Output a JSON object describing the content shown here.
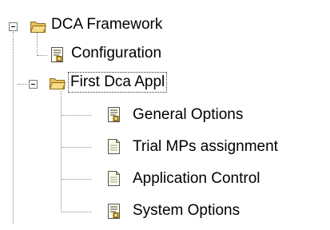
{
  "tree": {
    "root": {
      "label": "DCA Framework",
      "icon": "folder-open-icon",
      "expanded": true
    },
    "configuration": {
      "label": "Configuration",
      "icon": "settings-document-icon"
    },
    "app": {
      "label": "First Dca Appl",
      "icon": "folder-open-icon",
      "expanded": true,
      "selected": true
    },
    "app_children": [
      {
        "label": "General Options",
        "icon": "settings-document-icon"
      },
      {
        "label": "Trial MPs assignment",
        "icon": "document-icon"
      },
      {
        "label": "Application Control",
        "icon": "document-icon"
      },
      {
        "label": "System Options",
        "icon": "settings-document-icon"
      }
    ]
  },
  "colors": {
    "folder_fill": "#f5d77a",
    "folder_stroke": "#8a6d1f",
    "document_fill": "#fffde8",
    "settings_badge": "#c9a226"
  }
}
